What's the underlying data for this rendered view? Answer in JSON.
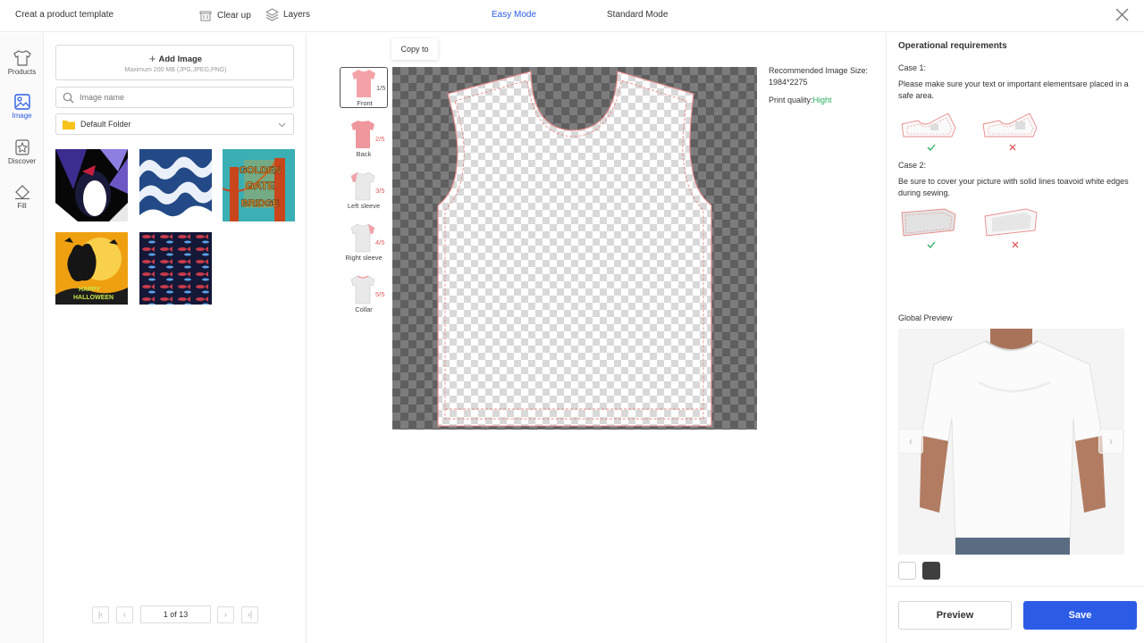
{
  "topbar": {
    "title": "Creat a product template",
    "clear_label": "Clear up",
    "layers_label": "Layers",
    "easy_mode": "Easy Mode",
    "standard_mode": "Standard Mode",
    "accent": "#2c5ce6"
  },
  "leftnav": {
    "items": [
      {
        "label": "Products",
        "icon": "tshirt-icon"
      },
      {
        "label": "Image",
        "icon": "image-icon",
        "active": true
      },
      {
        "label": "Discover",
        "icon": "star-icon"
      },
      {
        "label": "Fill",
        "icon": "paint-bucket-icon"
      }
    ]
  },
  "library": {
    "add_label": "Add Image",
    "add_hint": "Maximum 200 MB (JPG,JPEG,PNG)",
    "search_placeholder": "Image name",
    "folder": "Default Folder",
    "images": [
      {
        "name": "penguin-artwork"
      },
      {
        "name": "waves-pattern"
      },
      {
        "name": "golden-gate-bridge",
        "text": "GOLDEN GATE BRIDGE"
      },
      {
        "name": "halloween-artwork",
        "text": "HAPPY HALLOWEEN"
      },
      {
        "name": "fish-pattern"
      }
    ],
    "pagination": {
      "current": "1 of 13"
    }
  },
  "canvas": {
    "copy_to": "Copy to",
    "pieces": [
      {
        "label": "Front",
        "num": "1/5",
        "active": true
      },
      {
        "label": "Back",
        "num": "2/5"
      },
      {
        "label": "Left sleeve",
        "num": "3/5"
      },
      {
        "label": "Right sleeve",
        "num": "4/5"
      },
      {
        "label": "Collar",
        "num": "5/5"
      }
    ],
    "recommended_label": "Recommended Image Size:",
    "recommended_size": "1984*2275",
    "print_quality_label": "Print quality:",
    "print_quality_value": "Hight",
    "quality_color": "#27ae60"
  },
  "right": {
    "title": "Operational requirements",
    "case1_title": "Case 1:",
    "case1_text": "Please make sure your text or important elementsare placed in a safe area.",
    "case2_title": "Case 2:",
    "case2_text": "Be sure to cover your picture with solid lines toavoid white edges during sewing.",
    "global_preview": "Global Preview",
    "swatches": [
      "#ffffff",
      "#3f3f3f"
    ],
    "preview_button": "Preview",
    "save_button": "Save"
  }
}
